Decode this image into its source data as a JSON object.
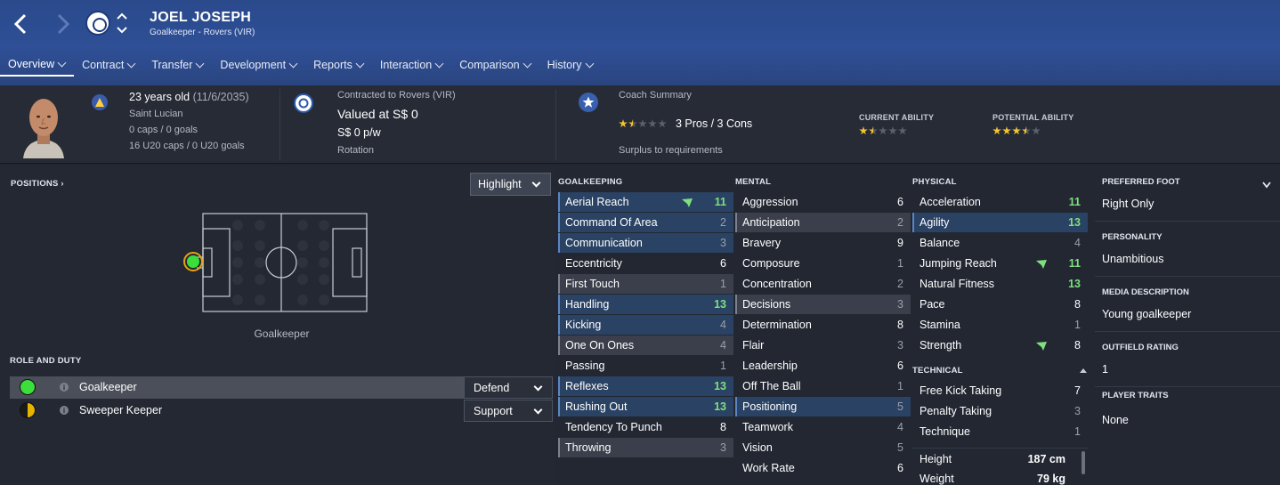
{
  "header": {
    "name": "JOEL JOSEPH",
    "subtitle": "Goalkeeper - Rovers (VIR)",
    "tabs": [
      {
        "label": "Overview"
      },
      {
        "label": "Contract"
      },
      {
        "label": "Transfer"
      },
      {
        "label": "Development"
      },
      {
        "label": "Reports"
      },
      {
        "label": "Interaction"
      },
      {
        "label": "Comparison"
      },
      {
        "label": "History"
      }
    ]
  },
  "summary": {
    "age": "23 years old",
    "dob": "(11/6/2035)",
    "nationality": "Saint Lucian",
    "caps": "0 caps / 0 goals",
    "u20caps": "16 U20 caps / 0 U20 goals",
    "contract_label": "Contracted to Rovers (VIR)",
    "value": "Valued at S$ 0",
    "wage": "S$ 0 p/w",
    "squad_status": "Rotation",
    "coach_summary_label": "Coach Summary",
    "pros_cons": "3 Pros / 3 Cons",
    "coach_rating": 1.5,
    "recommendation": "Surplus to requirements",
    "current_ability_label": "CURRENT ABILITY",
    "current_ability": 1.5,
    "potential_ability_label": "POTENTIAL ABILITY",
    "potential_ability": 3.5,
    "colors": {
      "star": "#f4c430",
      "star_empty": "#5b606c"
    }
  },
  "positions": {
    "label": "POSITIONS ›",
    "highlight_label": "Highlight",
    "position_name": "Goalkeeper"
  },
  "roles": {
    "label": "ROLE AND DUTY",
    "items": [
      {
        "name": "Goalkeeper",
        "duty": "Defend"
      },
      {
        "name": "Sweeper Keeper",
        "duty": "Support"
      }
    ]
  },
  "goalkeeping": {
    "label": "GOALKEEPING",
    "items": [
      {
        "name": "Aerial Reach",
        "value": "11"
      },
      {
        "name": "Command Of Area",
        "value": "2"
      },
      {
        "name": "Communication",
        "value": "3"
      },
      {
        "name": "Eccentricity",
        "value": "6"
      },
      {
        "name": "First Touch",
        "value": "1"
      },
      {
        "name": "Handling",
        "value": "13"
      },
      {
        "name": "Kicking",
        "value": "4"
      },
      {
        "name": "One On Ones",
        "value": "4"
      },
      {
        "name": "Passing",
        "value": "1"
      },
      {
        "name": "Reflexes",
        "value": "13"
      },
      {
        "name": "Rushing Out",
        "value": "13"
      },
      {
        "name": "Tendency To Punch",
        "value": "8"
      },
      {
        "name": "Throwing",
        "value": "3"
      }
    ]
  },
  "mental": {
    "label": "MENTAL",
    "items": [
      {
        "name": "Aggression",
        "value": "6"
      },
      {
        "name": "Anticipation",
        "value": "2"
      },
      {
        "name": "Bravery",
        "value": "9"
      },
      {
        "name": "Composure",
        "value": "1"
      },
      {
        "name": "Concentration",
        "value": "2"
      },
      {
        "name": "Decisions",
        "value": "3"
      },
      {
        "name": "Determination",
        "value": "8"
      },
      {
        "name": "Flair",
        "value": "3"
      },
      {
        "name": "Leadership",
        "value": "6"
      },
      {
        "name": "Off The Ball",
        "value": "1"
      },
      {
        "name": "Positioning",
        "value": "5"
      },
      {
        "name": "Teamwork",
        "value": "4"
      },
      {
        "name": "Vision",
        "value": "5"
      },
      {
        "name": "Work Rate",
        "value": "6"
      }
    ]
  },
  "physical": {
    "label": "PHYSICAL",
    "items": [
      {
        "name": "Acceleration",
        "value": "11"
      },
      {
        "name": "Agility",
        "value": "13"
      },
      {
        "name": "Balance",
        "value": "4"
      },
      {
        "name": "Jumping Reach",
        "value": "11"
      },
      {
        "name": "Natural Fitness",
        "value": "13"
      },
      {
        "name": "Pace",
        "value": "8"
      },
      {
        "name": "Stamina",
        "value": "1"
      },
      {
        "name": "Strength",
        "value": "8"
      }
    ]
  },
  "technical": {
    "label": "TECHNICAL",
    "items": [
      {
        "name": "Free Kick Taking",
        "value": "7"
      },
      {
        "name": "Penalty Taking",
        "value": "3"
      },
      {
        "name": "Technique",
        "value": "1"
      }
    ]
  },
  "bio": {
    "height_label": "Height",
    "height": "187 cm",
    "weight_label": "Weight",
    "weight": "79 kg"
  },
  "info": {
    "preferred_foot_label": "PREFERRED FOOT",
    "preferred_foot": "Right Only",
    "personality_label": "PERSONALITY",
    "personality": "Unambitious",
    "media_label": "MEDIA DESCRIPTION",
    "media": "Young goalkeeper",
    "outfield_label": "OUTFIELD RATING",
    "outfield": "1",
    "traits_label": "PLAYER TRAITS",
    "traits": "None"
  }
}
